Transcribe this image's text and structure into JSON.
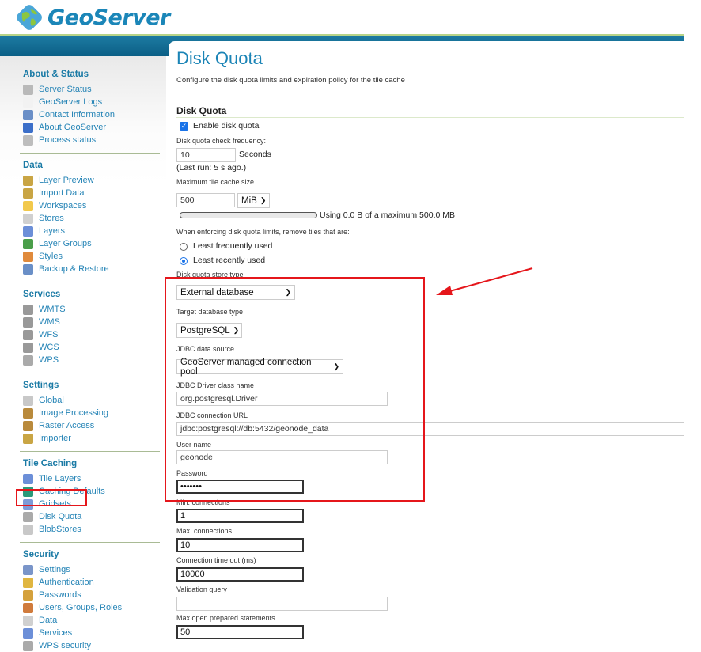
{
  "header": {
    "brand": "GeoServer",
    "logo_icon": "geoserver-globe-logo"
  },
  "sidebar": {
    "sections": [
      {
        "title": "About & Status",
        "items": [
          {
            "label": "Server Status",
            "icon": "server-status-icon"
          },
          {
            "label": "GeoServer Logs",
            "icon": "document-icon"
          },
          {
            "label": "Contact Information",
            "icon": "contact-card-icon"
          },
          {
            "label": "About GeoServer",
            "icon": "info-globe-icon"
          },
          {
            "label": "Process status",
            "icon": "gear-icon"
          }
        ]
      },
      {
        "title": "Data",
        "items": [
          {
            "label": "Layer Preview",
            "icon": "map-preview-icon"
          },
          {
            "label": "Import Data",
            "icon": "map-import-icon"
          },
          {
            "label": "Workspaces",
            "icon": "folder-icon"
          },
          {
            "label": "Stores",
            "icon": "database-icon"
          },
          {
            "label": "Layers",
            "icon": "layer-icon"
          },
          {
            "label": "Layer Groups",
            "icon": "layer-group-icon"
          },
          {
            "label": "Styles",
            "icon": "palette-icon"
          },
          {
            "label": "Backup & Restore",
            "icon": "backup-icon"
          }
        ]
      },
      {
        "title": "Services",
        "items": [
          {
            "label": "WMTS",
            "icon": "server-wmts-icon"
          },
          {
            "label": "WMS",
            "icon": "server-wms-icon"
          },
          {
            "label": "WFS",
            "icon": "server-wfs-icon"
          },
          {
            "label": "WCS",
            "icon": "server-wcs-icon"
          },
          {
            "label": "WPS",
            "icon": "server-wps-icon"
          }
        ]
      },
      {
        "title": "Settings",
        "items": [
          {
            "label": "Global",
            "icon": "server-icon"
          },
          {
            "label": "Image Processing",
            "icon": "image-processing-icon"
          },
          {
            "label": "Raster Access",
            "icon": "raster-icon"
          },
          {
            "label": "Importer",
            "icon": "importer-icon"
          }
        ]
      },
      {
        "title": "Tile Caching",
        "items": [
          {
            "label": "Tile Layers",
            "icon": "tile-grid-icon"
          },
          {
            "label": "Caching Defaults",
            "icon": "globe-arrows-icon"
          },
          {
            "label": "Gridsets",
            "icon": "grid-icon"
          },
          {
            "label": "Disk Quota",
            "icon": "disk-icon"
          },
          {
            "label": "BlobStores",
            "icon": "blobstore-icon"
          }
        ]
      },
      {
        "title": "Security",
        "items": [
          {
            "label": "Settings",
            "icon": "wrench-icon"
          },
          {
            "label": "Authentication",
            "icon": "shield-icon"
          },
          {
            "label": "Passwords",
            "icon": "lock-icon"
          },
          {
            "label": "Users, Groups, Roles",
            "icon": "users-icon"
          },
          {
            "label": "Data",
            "icon": "data-key-icon"
          },
          {
            "label": "Services",
            "icon": "services-key-icon"
          },
          {
            "label": "WPS security",
            "icon": "wps-security-icon"
          }
        ]
      }
    ]
  },
  "main": {
    "title": "Disk Quota",
    "description": "Configure the disk quota limits and expiration policy for the tile cache",
    "section_title": "Disk Quota",
    "enable_label": "Enable disk quota",
    "enable_checked": true,
    "check_frequency_label": "Disk quota check frequency:",
    "check_frequency_value": "10",
    "check_frequency_unit": "Seconds",
    "last_run": "(Last run: 5 s ago.)",
    "max_size_label": "Maximum tile cache size",
    "max_size_value": "500",
    "max_size_unit": "MiB",
    "usage_fraction": 0.0,
    "usage_text": "Using 0.0 B of a maximum 500.0 MB",
    "policy_label": "When enforcing disk quota limits, remove tiles that are:",
    "policy_options": [
      {
        "label": "Least frequently used",
        "selected": false
      },
      {
        "label": "Least recently used",
        "selected": true
      }
    ],
    "store_type_label": "Disk quota store type",
    "store_type_value": "External database",
    "db_type_label": "Target database type",
    "db_type_value": "PostgreSQL",
    "jdbc_source_label": "JDBC data source",
    "jdbc_source_value": "GeoServer managed connection pool",
    "driver_label": "JDBC Driver class name",
    "driver_value": "org.postgresql.Driver",
    "url_label": "JDBC connection URL",
    "url_value": "jdbc:postgresql://db:5432/geonode_data",
    "user_label": "User name",
    "user_value": "geonode",
    "password_label": "Password",
    "password_value": "•••••••",
    "min_conn_label": "Min. connections",
    "min_conn_value": "1",
    "max_conn_label": "Max. connections",
    "max_conn_value": "10",
    "timeout_label": "Connection time out (ms)",
    "timeout_value": "10000",
    "validation_label": "Validation query",
    "validation_value": "",
    "max_stmt_label": "Max open prepared statements",
    "max_stmt_value": "50"
  },
  "colors": {
    "accent_blue": "#1b84b6",
    "header_band": "#0b5f86",
    "annotation_red": "#e5161b"
  }
}
